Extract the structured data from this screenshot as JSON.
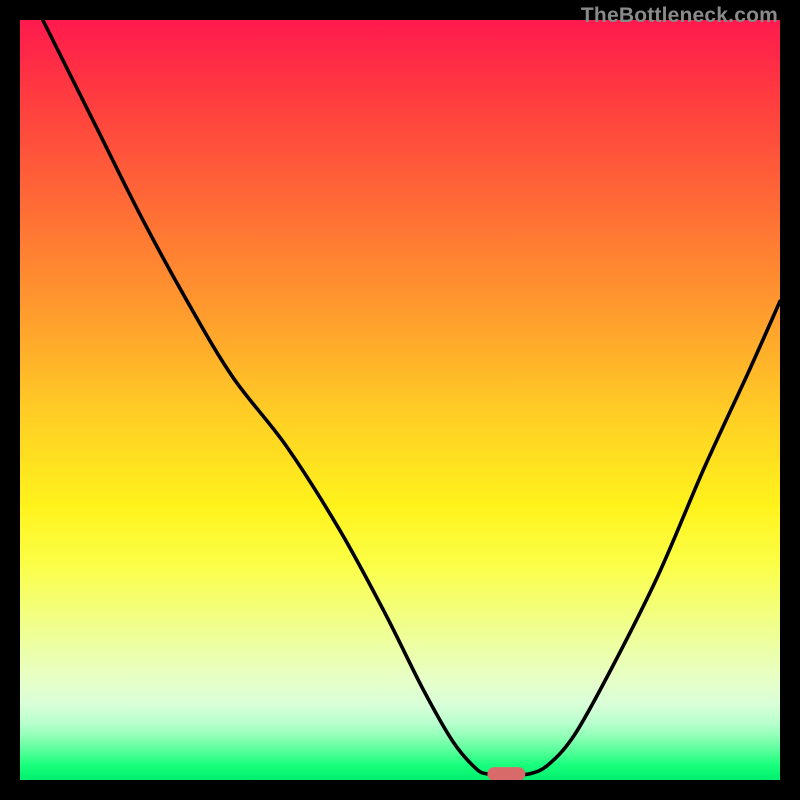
{
  "watermark": {
    "text": "TheBottleneck.com"
  },
  "chart_data": {
    "type": "line",
    "title": "",
    "subtitle": "",
    "xlabel": "",
    "ylabel": "",
    "xlim": [
      0,
      100
    ],
    "ylim": [
      0,
      100
    ],
    "grid": false,
    "legend": false,
    "background_gradient_stops": [
      {
        "pct": 0,
        "color": "#ff1a4d"
      },
      {
        "pct": 10,
        "color": "#ff3b40"
      },
      {
        "pct": 24,
        "color": "#ff6a36"
      },
      {
        "pct": 38,
        "color": "#ff9a2e"
      },
      {
        "pct": 52,
        "color": "#ffce25"
      },
      {
        "pct": 64,
        "color": "#fff31c"
      },
      {
        "pct": 72,
        "color": "#fbff4a"
      },
      {
        "pct": 78,
        "color": "#f2ff7e"
      },
      {
        "pct": 83,
        "color": "#ecffa9"
      },
      {
        "pct": 87,
        "color": "#e6ffc9"
      },
      {
        "pct": 90,
        "color": "#d9ffd8"
      },
      {
        "pct": 92.5,
        "color": "#b9ffce"
      },
      {
        "pct": 94.5,
        "color": "#8affb3"
      },
      {
        "pct": 96.5,
        "color": "#4cff95"
      },
      {
        "pct": 98,
        "color": "#19ff7d"
      },
      {
        "pct": 100,
        "color": "#00ef6e"
      }
    ],
    "series": [
      {
        "name": "bottleneck-curve",
        "color": "#000000",
        "x": [
          3,
          10,
          16,
          22,
          28,
          35,
          42,
          48,
          53,
          57,
          60,
          61.5,
          63,
          65,
          67,
          69.5,
          73,
          78,
          84,
          90,
          96,
          100
        ],
        "y": [
          100,
          86,
          74,
          63,
          53,
          44,
          33,
          22,
          12,
          5,
          1.5,
          0.8,
          0.8,
          0.8,
          0.8,
          2,
          6,
          15,
          27,
          41,
          54,
          63
        ]
      }
    ],
    "marker": {
      "name": "optimal-point",
      "shape": "pill",
      "color": "#d86a6a",
      "x": 64,
      "y": 0.8,
      "width": 5,
      "height": 1.8
    }
  }
}
